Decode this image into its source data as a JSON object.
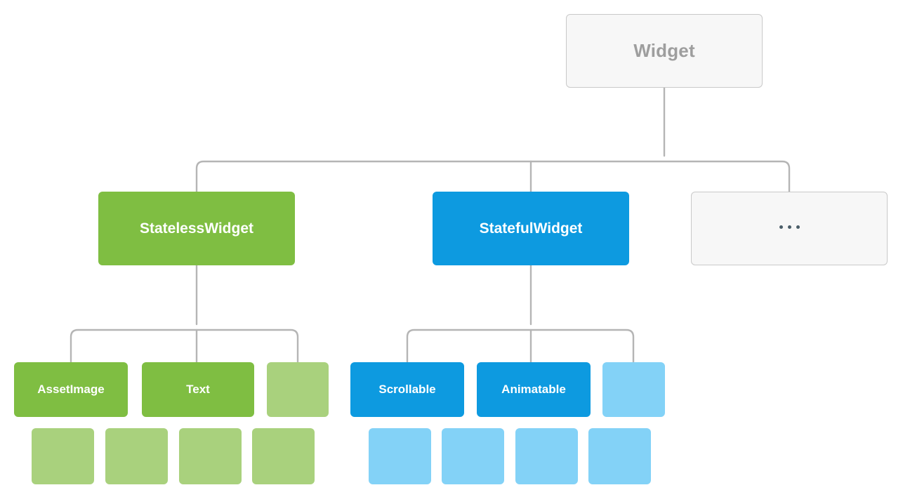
{
  "diagram": {
    "title_text": "Widget",
    "type": "class-hierarchy-tree",
    "background_color": "#ffffff",
    "connector_color": "#b5b5b5",
    "palette": {
      "green": "#7fbe42",
      "green_light": "#a9d17d",
      "blue": "#0d9ae0",
      "blue_light": "#83d2f7",
      "outline_fill": "#f7f7f7",
      "outline_border": "#c9c9c9",
      "outline_text": "#9e9e9e",
      "dot_color": "#4a5d68"
    }
  },
  "nodes": {
    "root": {
      "label": "Widget",
      "style": "outline"
    },
    "level2": [
      {
        "label": "StatelessWidget",
        "style": "green"
      },
      {
        "label": "StatefulWidget",
        "style": "blue"
      },
      {
        "label": "",
        "style": "outline",
        "icon": "ellipsis-dots"
      }
    ],
    "level3_stateless": [
      {
        "label": "AssetImage",
        "style": "green"
      },
      {
        "label": "Text",
        "style": "green"
      },
      {
        "label": "",
        "style": "green-light"
      }
    ],
    "level3_stateful": [
      {
        "label": "Scrollable",
        "style": "blue"
      },
      {
        "label": "Animatable",
        "style": "blue"
      },
      {
        "label": "",
        "style": "blue-light"
      }
    ],
    "level4_stateless": [
      {
        "label": "",
        "style": "green-light"
      },
      {
        "label": "",
        "style": "green-light"
      },
      {
        "label": "",
        "style": "green-light"
      },
      {
        "label": "",
        "style": "green-light"
      }
    ],
    "level4_stateful": [
      {
        "label": "",
        "style": "blue-light"
      },
      {
        "label": "",
        "style": "blue-light"
      },
      {
        "label": "",
        "style": "blue-light"
      },
      {
        "label": "",
        "style": "blue-light"
      }
    ]
  }
}
